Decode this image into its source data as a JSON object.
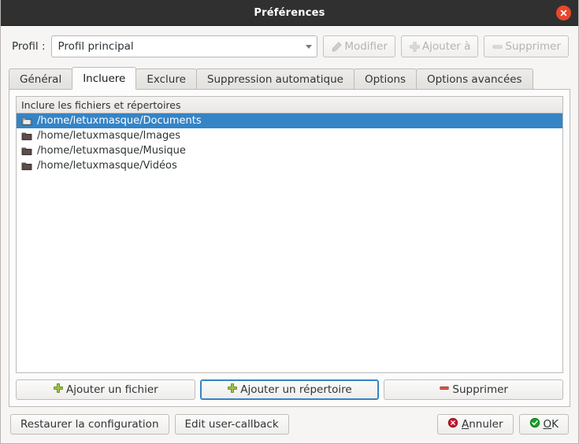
{
  "window": {
    "title": "Préférences",
    "close_icon": "close-icon"
  },
  "profile": {
    "label": "Profil :",
    "combo_value": "Profil principal",
    "combo_arrow_icon": "chevron-down-icon",
    "buttons": [
      {
        "label": "Modifier",
        "icon": "pencil-icon",
        "enabled": false
      },
      {
        "label": "Ajouter à",
        "icon": "plus-icon",
        "enabled": false
      },
      {
        "label": "Supprimer",
        "icon": "minus-icon",
        "enabled": false
      }
    ]
  },
  "tabs": [
    {
      "label": "Général",
      "active": false
    },
    {
      "label": "Incluere",
      "active": true
    },
    {
      "label": "Exclure",
      "active": false
    },
    {
      "label": "Suppression automatique",
      "active": false
    },
    {
      "label": "Options",
      "active": false
    },
    {
      "label": "Options avancées",
      "active": false
    }
  ],
  "list": {
    "header": "Inclure les fichiers et répertoires",
    "rows": [
      {
        "path": "/home/letuxmasque/Documents",
        "icon": "folder-icon",
        "selected": true
      },
      {
        "path": "/home/letuxmasque/Images",
        "icon": "folder-icon",
        "selected": false
      },
      {
        "path": "/home/letuxmasque/Musique",
        "icon": "folder-icon",
        "selected": false
      },
      {
        "path": "/home/letuxmasque/Vidéos",
        "icon": "folder-icon",
        "selected": false
      }
    ]
  },
  "actions": [
    {
      "label": "Ajouter un fichier",
      "icon": "plus-icon",
      "focused": false
    },
    {
      "label": "Ajouter un répertoire",
      "icon": "plus-icon",
      "focused": true
    },
    {
      "label": "Supprimer",
      "icon": "minus-icon",
      "focused": false
    }
  ],
  "footer": {
    "restore_label": "Restaurer la configuration",
    "edit_callback_label": "Edit user-callback",
    "cancel": {
      "mnemonic": "A",
      "rest": "nnuler",
      "icon": "error-circle-icon"
    },
    "ok": {
      "mnemonic": "O",
      "rest": "K",
      "icon": "check-circle-icon"
    }
  },
  "colors": {
    "titlebar_bg": "#303030",
    "close_btn": "#e8482a",
    "selection": "#3584c6",
    "dialog_bg": "#f6f5f4",
    "panel_bg": "#fcfcfc",
    "accent_green": "#8bb83a",
    "accent_red": "#cc3b34",
    "ok_green": "#1f9d2f"
  }
}
